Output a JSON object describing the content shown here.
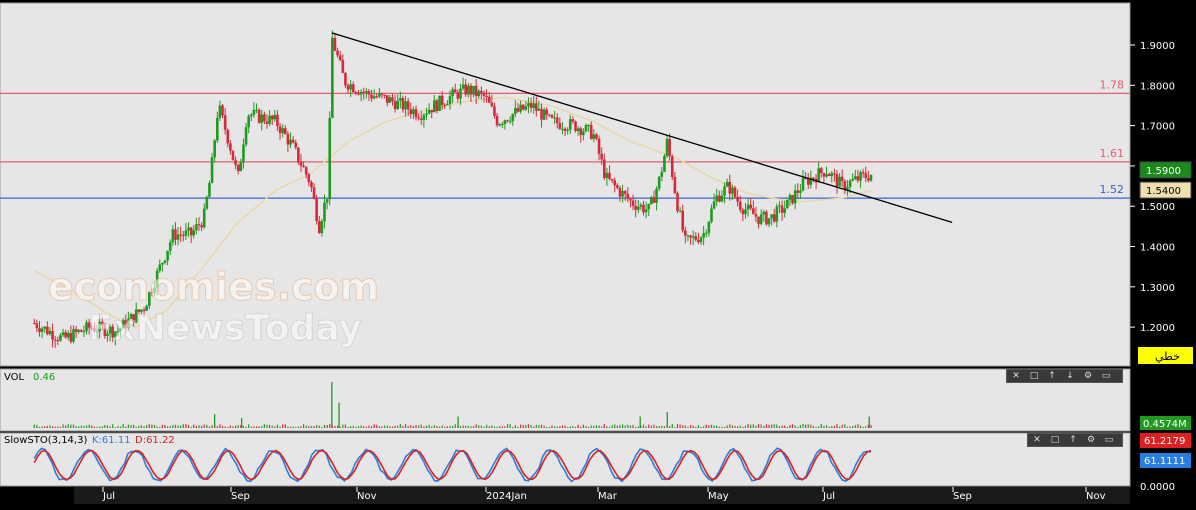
{
  "chart_data": [
    {
      "type": "candlestick",
      "panel": "price",
      "y_ticks": [
        "1.9000",
        "1.8000",
        "1.7000",
        "1.6000",
        "1.5000",
        "1.4000",
        "1.3000",
        "1.2000"
      ],
      "ylim": [
        1.11,
        1.97
      ],
      "x_ticks": [
        "Jul",
        "Sep",
        "Nov",
        "2024Jan",
        "Mar",
        "May",
        "Jul",
        "Sep",
        "Nov"
      ],
      "horizontal_levels": [
        {
          "label": "1.78",
          "value": 1.78,
          "color": "#e06070"
        },
        {
          "label": "1.61",
          "value": 1.61,
          "color": "#e06070"
        },
        {
          "label": "1.52",
          "value": 1.52,
          "color": "#3a62d8"
        }
      ],
      "trendline": {
        "start": {
          "x": "2023-11-01",
          "y": 1.93
        },
        "end": {
          "x": "2024-10-10",
          "y": 1.46
        }
      },
      "moving_average_color": "#e8d8a8",
      "price_badges": [
        {
          "value": "1.5900",
          "bg": "#1a8a1a",
          "fg": "#ffffff"
        },
        {
          "value": "1.5400",
          "bg": "#f0e0b0",
          "fg": "#000000"
        }
      ],
      "button_label": "خطي",
      "path": [
        [
          "2023-05-20",
          1.21
        ],
        [
          "2023-06-05",
          1.17
        ],
        [
          "2023-06-20",
          1.2
        ],
        [
          "2023-07-05",
          1.19
        ],
        [
          "2023-07-20",
          1.25
        ],
        [
          "2023-07-27",
          1.33
        ],
        [
          "2023-08-05",
          1.43
        ],
        [
          "2023-08-15",
          1.43
        ],
        [
          "2023-08-22",
          1.47
        ],
        [
          "2023-08-26",
          1.58
        ],
        [
          "2023-08-30",
          1.75
        ],
        [
          "2023-09-05",
          1.66
        ],
        [
          "2023-09-10",
          1.57
        ],
        [
          "2023-09-15",
          1.73
        ],
        [
          "2023-10-01",
          1.71
        ],
        [
          "2023-10-10",
          1.65
        ],
        [
          "2023-10-20",
          1.56
        ],
        [
          "2023-10-25",
          1.45
        ],
        [
          "2023-10-30",
          1.54
        ],
        [
          "2023-11-01",
          1.92
        ],
        [
          "2023-11-08",
          1.81
        ],
        [
          "2023-11-20",
          1.78
        ],
        [
          "2023-12-05",
          1.76
        ],
        [
          "2023-12-20",
          1.73
        ],
        [
          "2024-01-05",
          1.77
        ],
        [
          "2024-01-15",
          1.79
        ],
        [
          "2024-01-25",
          1.77
        ],
        [
          "2024-02-01",
          1.71
        ],
        [
          "2024-02-10",
          1.73
        ],
        [
          "2024-02-20",
          1.75
        ],
        [
          "2024-03-01",
          1.71
        ],
        [
          "2024-03-15",
          1.7
        ],
        [
          "2024-03-25",
          1.68
        ],
        [
          "2024-04-01",
          1.57
        ],
        [
          "2024-04-15",
          1.51
        ],
        [
          "2024-04-25",
          1.49
        ],
        [
          "2024-05-01",
          1.57
        ],
        [
          "2024-05-05",
          1.66
        ],
        [
          "2024-05-10",
          1.52
        ],
        [
          "2024-05-15",
          1.41
        ],
        [
          "2024-05-25",
          1.43
        ],
        [
          "2024-06-01",
          1.52
        ],
        [
          "2024-06-08",
          1.55
        ],
        [
          "2024-06-15",
          1.5
        ],
        [
          "2024-06-25",
          1.47
        ],
        [
          "2024-07-01",
          1.47
        ],
        [
          "2024-07-10",
          1.5
        ],
        [
          "2024-07-20",
          1.56
        ],
        [
          "2024-08-01",
          1.59
        ],
        [
          "2024-08-10",
          1.55
        ],
        [
          "2024-08-20",
          1.57
        ],
        [
          "2024-08-27",
          1.58
        ]
      ],
      "moving_average": [
        [
          "2023-05-20",
          1.34
        ],
        [
          "2023-06-10",
          1.29
        ],
        [
          "2023-07-01",
          1.23
        ],
        [
          "2023-07-15",
          1.2
        ],
        [
          "2023-08-01",
          1.24
        ],
        [
          "2023-08-20",
          1.34
        ],
        [
          "2023-09-10",
          1.46
        ],
        [
          "2023-10-01",
          1.54
        ],
        [
          "2023-10-20",
          1.58
        ],
        [
          "2023-11-10",
          1.66
        ],
        [
          "2023-12-01",
          1.71
        ],
        [
          "2023-12-25",
          1.74
        ],
        [
          "2024-01-15",
          1.76
        ],
        [
          "2024-02-05",
          1.77
        ],
        [
          "2024-03-01",
          1.75
        ],
        [
          "2024-03-25",
          1.71
        ],
        [
          "2024-04-15",
          1.66
        ],
        [
          "2024-05-10",
          1.62
        ],
        [
          "2024-05-30",
          1.57
        ],
        [
          "2024-06-20",
          1.53
        ],
        [
          "2024-07-15",
          1.51
        ],
        [
          "2024-08-10",
          1.52
        ],
        [
          "2024-08-27",
          1.54
        ]
      ]
    },
    {
      "type": "bar",
      "panel": "volume",
      "label": "VOL",
      "value_text": "0.46",
      "badge": "0.4574M",
      "spikes": [
        {
          "x": "2023-08-28",
          "value": 0.3
        },
        {
          "x": "2023-09-12",
          "value": 0.22
        },
        {
          "x": "2023-11-01",
          "value": 1.0
        },
        {
          "x": "2023-11-05",
          "value": 0.55
        },
        {
          "x": "2024-01-10",
          "value": 0.25
        },
        {
          "x": "2024-04-20",
          "value": 0.25
        },
        {
          "x": "2024-05-05",
          "value": 0.35
        },
        {
          "x": "2024-08-25",
          "value": 0.25
        }
      ]
    },
    {
      "type": "line",
      "panel": "oscillator",
      "label": "SlowSTO(3,14,3)",
      "k_label": "K:61.11",
      "d_label": "D:61.22",
      "y_ticks": [
        "0.0000"
      ],
      "badges": [
        {
          "value": "61.2179",
          "bg": "#e02020",
          "fg": "#ffffff"
        },
        {
          "value": "61.1111",
          "bg": "#2a7de1",
          "fg": "#ffffff"
        }
      ],
      "series": [
        {
          "name": "K",
          "color": "#2a7de1"
        },
        {
          "name": "D",
          "color": "#e02020"
        }
      ]
    }
  ]
}
